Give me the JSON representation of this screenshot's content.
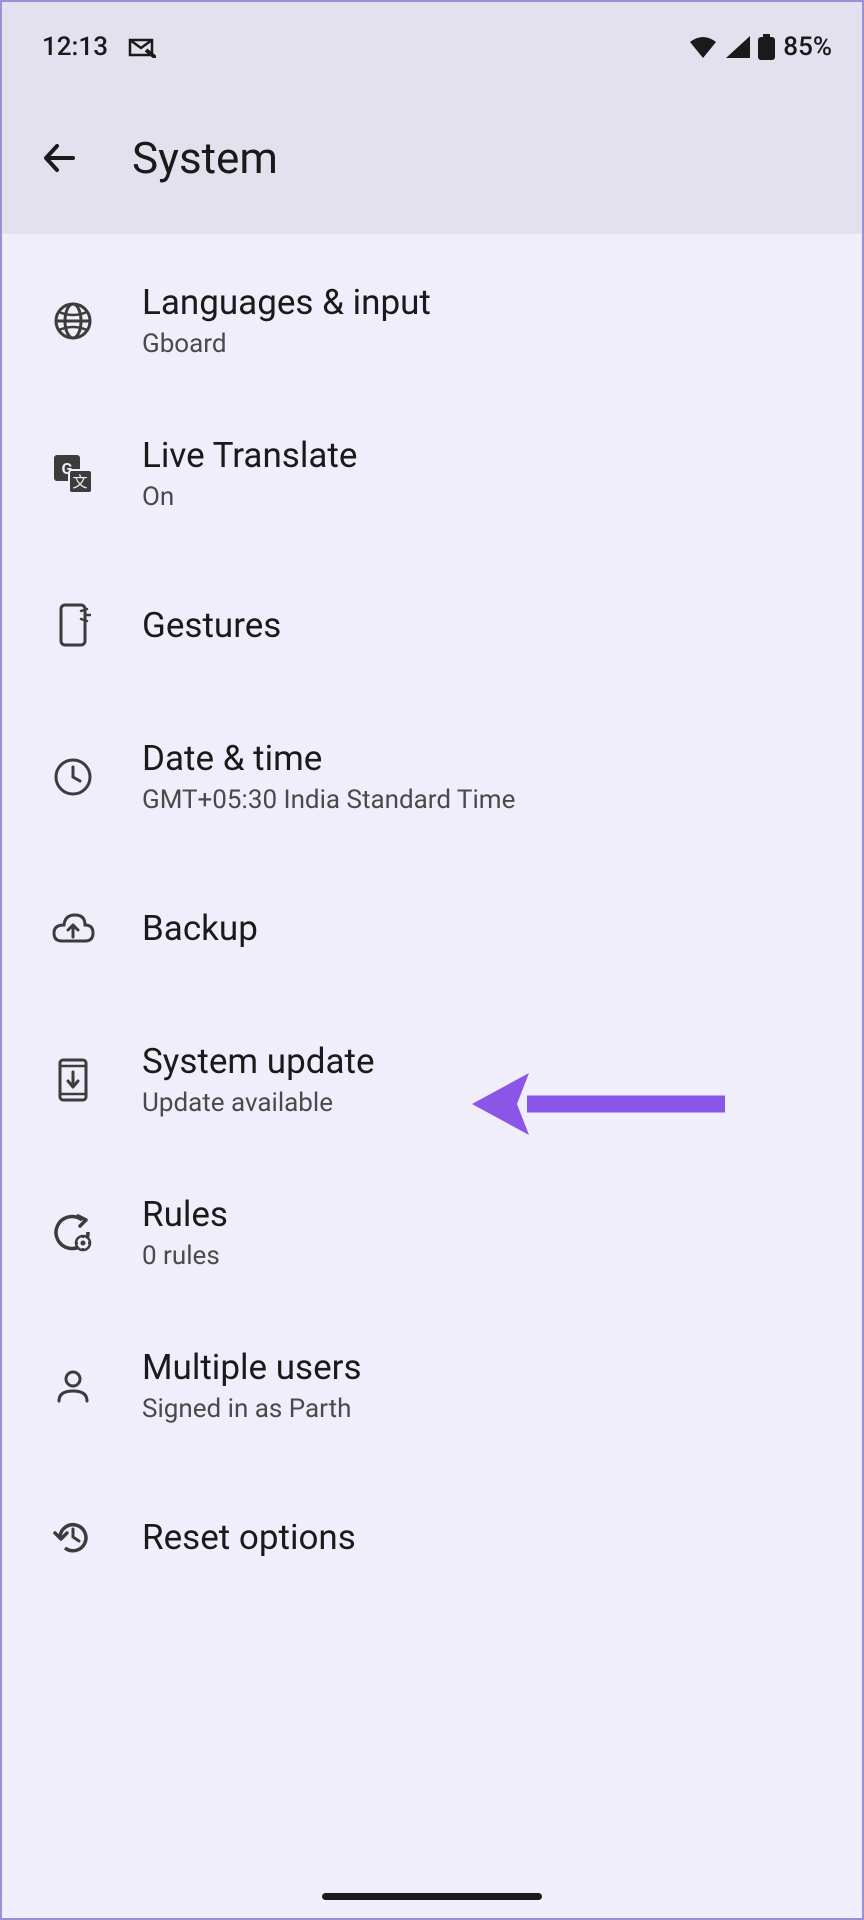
{
  "status_bar": {
    "time": "12:13",
    "battery_percent": "85%"
  },
  "header": {
    "title": "System"
  },
  "settings": {
    "languages": {
      "title": "Languages & input",
      "subtitle": "Gboard"
    },
    "translate": {
      "title": "Live Translate",
      "subtitle": "On"
    },
    "gestures": {
      "title": "Gestures"
    },
    "datetime": {
      "title": "Date & time",
      "subtitle": "GMT+05:30 India Standard Time"
    },
    "backup": {
      "title": "Backup"
    },
    "update": {
      "title": "System update",
      "subtitle": "Update available"
    },
    "rules": {
      "title": "Rules",
      "subtitle": "0 rules"
    },
    "users": {
      "title": "Multiple users",
      "subtitle": "Signed in as Parth"
    },
    "reset": {
      "title": "Reset options"
    }
  }
}
